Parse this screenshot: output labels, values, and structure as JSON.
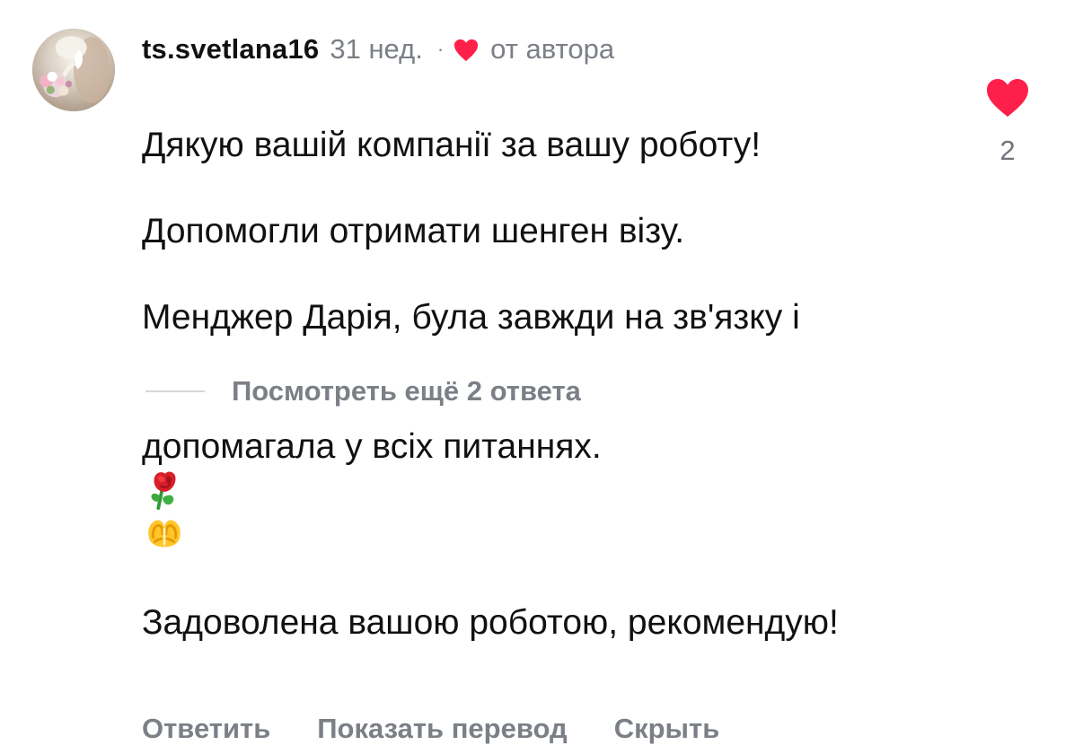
{
  "comment": {
    "username": "ts.svetlana16",
    "time": "31 нед.",
    "separator": "·",
    "author_label": "от автора",
    "text_lines": [
      "Дякую вашій компанії за вашу роботу!",
      "Допомогли отримати шенген візу.",
      "Менджер Дарія, була завжди на зв'язку і",
      "допомагала у всіх питаннях.",
      "Задоволена вашою роботою, рекомендую!"
    ],
    "emojis": [
      "rose-icon",
      "heart-hands-icon"
    ],
    "actions": {
      "reply": "Ответить",
      "translate": "Показать перевод",
      "hide": "Скрыть"
    },
    "replies": "Посмотреть ещё 2 ответа",
    "like_count": "2",
    "accent": "#ff1f4b",
    "muted": "#7b7f86"
  }
}
